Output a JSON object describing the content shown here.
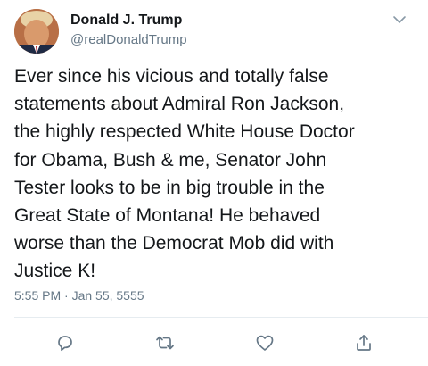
{
  "tweet": {
    "display_name": "Donald J. Trump",
    "handle": "@realDonaldTrump",
    "text": "Ever since his vicious and totally false\nstatements about Admiral Ron Jackson,\nthe highly respected White House Doctor\nfor Obama, Bush & me, Senator John\nTester looks to be in big trouble in the\nGreat State of Montana! He behaved\nworse than the Democrat Mob did with\nJustice K!",
    "timestamp": "5:55 PM · Jan 55, 5555"
  },
  "icons": {
    "menu": "chevron-down-icon",
    "reply": "reply-icon",
    "retweet": "retweet-icon",
    "like": "heart-icon",
    "share": "share-icon"
  },
  "colors": {
    "text": "#14171a",
    "secondary": "#657786",
    "divider": "#e6ecf0"
  }
}
